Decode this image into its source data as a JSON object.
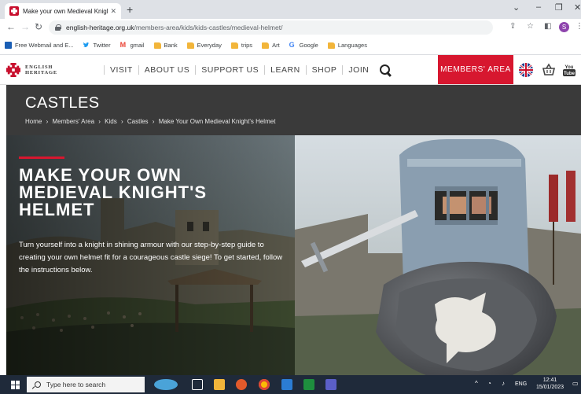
{
  "browser": {
    "tab_title": "Make your own Medieval Knight’s",
    "url_domain": "english-heritage.org.uk",
    "url_path": "/members-area/kids/kids-castles/medieval-helmet/",
    "bookmarks": [
      {
        "label": "Free Webmail and E...",
        "icon": "mail-icon",
        "color": "#1b5fb5"
      },
      {
        "label": "Twitter",
        "icon": "twitter-bird-icon",
        "color": "#1d9bf0"
      },
      {
        "label": "gmail",
        "icon": "gmail-icon",
        "color": "#ea4335"
      },
      {
        "label": "Bank",
        "icon": "folder-icon",
        "color": "#f2b53a"
      },
      {
        "label": "Everyday",
        "icon": "folder-icon",
        "color": "#f2b53a"
      },
      {
        "label": "trips",
        "icon": "folder-icon",
        "color": "#f2b53a"
      },
      {
        "label": "Art",
        "icon": "folder-icon",
        "color": "#f2b53a"
      },
      {
        "label": "Google",
        "icon": "google-icon",
        "color": "#4285f4"
      },
      {
        "label": "Languages",
        "icon": "folder-icon",
        "color": "#f2b53a"
      }
    ],
    "profile_initial": "S"
  },
  "site": {
    "logo_line1": "ENGLISH",
    "logo_line2": "HERITAGE",
    "nav": [
      "VISIT",
      "ABOUT US",
      "SUPPORT US",
      "LEARN",
      "SHOP",
      "JOIN"
    ],
    "members_label": "MEMBERS' AREA",
    "brand_color": "#d7172f"
  },
  "section": {
    "title": "CASTLES",
    "breadcrumb": [
      "Home",
      "Members' Area",
      "Kids",
      "Castles",
      "Make Your Own Medieval Knight's Helmet"
    ],
    "separator": "›"
  },
  "hero": {
    "title_lines": [
      "MAKE YOUR OWN",
      "MEDIEVAL KNIGHT'S",
      "HELMET"
    ],
    "text": "Turn yourself into a knight in shining armour with our step-by-step guide to creating your own helmet fit for a courageous castle siege! To get started, follow the instructions below."
  },
  "taskbar": {
    "search_placeholder": "Type here to search",
    "lang": "ENG",
    "time": "12:41",
    "date": "15/01/2023"
  }
}
